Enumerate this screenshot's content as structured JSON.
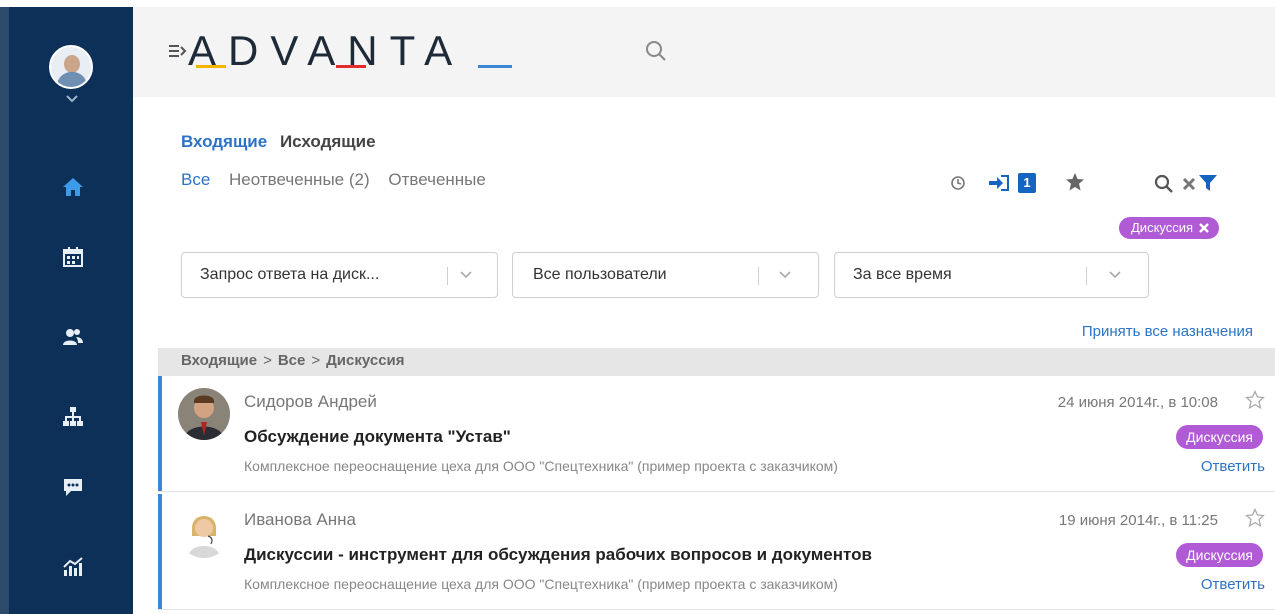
{
  "app": {
    "logo": "ADVANTA",
    "accent": "#2b73c7",
    "tag_color": "#b05ad6",
    "sidebar_color": "#0d3058"
  },
  "sidebar": {
    "icons": [
      "home-icon",
      "calendar-icon",
      "users-icon",
      "org-structure-icon",
      "chat-icon",
      "analytics-icon"
    ]
  },
  "tabs_direction": {
    "active": "Входящие",
    "other": "Исходящие"
  },
  "tabs_status": {
    "all": "Все",
    "unanswered": "Неотвеченные (2)",
    "answered": "Отвеченные"
  },
  "toolbar": {
    "incoming_count": "1",
    "active_filter": "Дискуссия"
  },
  "filters": {
    "type": "Запрос ответа на диск...",
    "users": "Все пользователи",
    "period": "За все время"
  },
  "accept_all": "Принять все назначения",
  "breadcrumb": [
    "Входящие",
    "Все",
    "Дискуссия"
  ],
  "messages": [
    {
      "author": "Сидоров Андрей",
      "date": "24 июня 2014г., в 10:08",
      "subject": "Обсуждение документа \"Устав\"",
      "tag": "Дискуссия",
      "project": "Комплексное переоснащение цеха для ООО \"Спецтехника\" (пример проекта с заказчиком)",
      "reply": "Ответить"
    },
    {
      "author": "Иванова Анна",
      "date": "19 июня 2014г., в 11:25",
      "subject": "Дискуссии - инструмент для обсуждения рабочих вопросов и документов",
      "tag": "Дискуссия",
      "project": "Комплексное переоснащение цеха для ООО \"Спецтехника\" (пример проекта с заказчиком)",
      "reply": "Ответить"
    }
  ]
}
